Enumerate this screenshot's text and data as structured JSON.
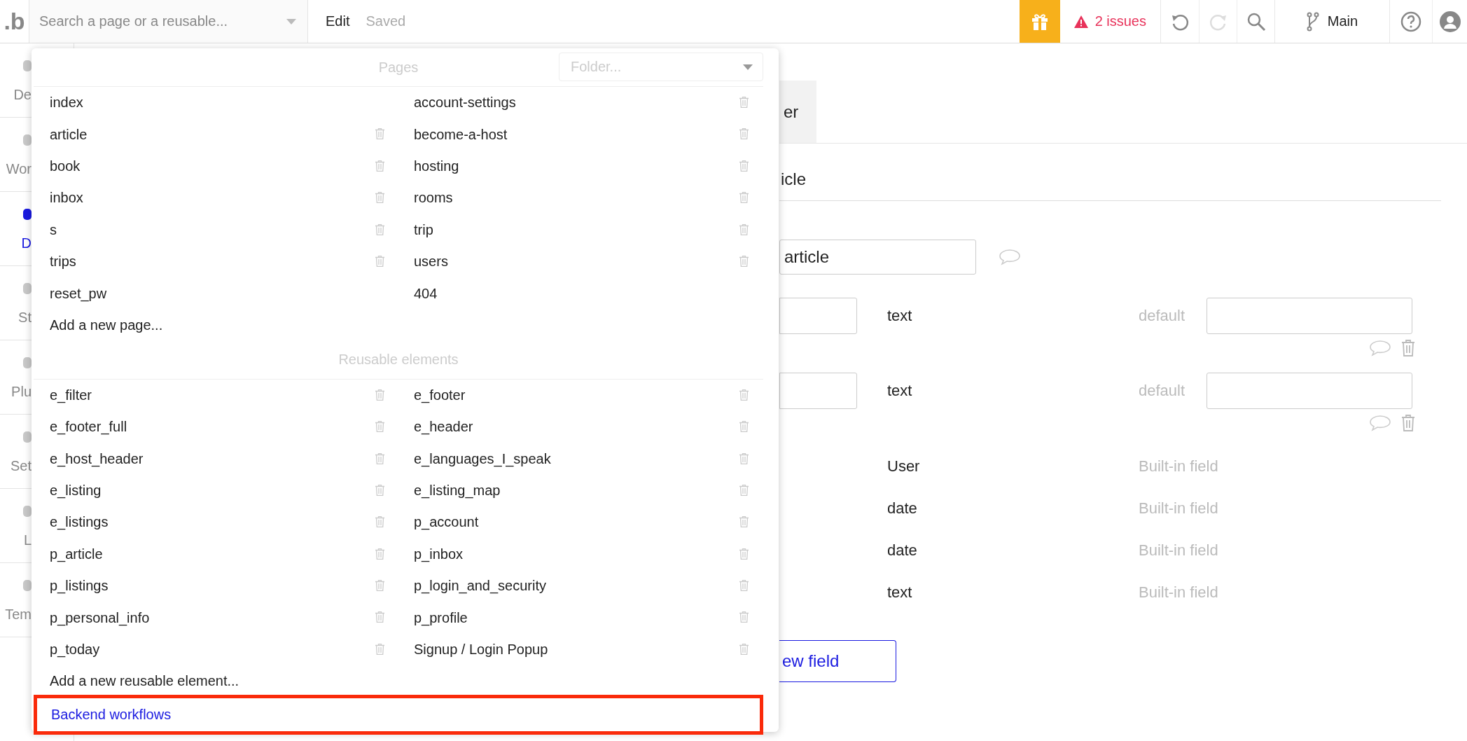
{
  "header": {
    "logo": ".b",
    "search": {
      "placeholder": "Search a page or a reusable..."
    },
    "mode": "Edit",
    "save_status": "Saved",
    "issues": "2 issues",
    "undo_disabled": false,
    "redo_disabled": true,
    "branch": "Main"
  },
  "sidebar": {
    "items": [
      {
        "label": "De",
        "selected": false
      },
      {
        "label": "Wor",
        "selected": false
      },
      {
        "label": "D",
        "selected": true
      },
      {
        "label": "St",
        "selected": false
      },
      {
        "label": "Plu",
        "selected": false
      },
      {
        "label": "Set",
        "selected": false
      },
      {
        "label": "L",
        "selected": false
      },
      {
        "label": "Tem",
        "selected": false
      }
    ]
  },
  "page_menu": {
    "folder": {
      "placeholder": "Folder..."
    },
    "sections": [
      {
        "title": "Pages",
        "add_label": "Add a new page...",
        "items": [
          {
            "name": "index",
            "deletable": false
          },
          {
            "name": "account-settings",
            "deletable": true
          },
          {
            "name": "article",
            "deletable": true
          },
          {
            "name": "become-a-host",
            "deletable": true
          },
          {
            "name": "book",
            "deletable": true
          },
          {
            "name": "hosting",
            "deletable": true
          },
          {
            "name": "inbox",
            "deletable": true
          },
          {
            "name": "rooms",
            "deletable": true
          },
          {
            "name": "s",
            "deletable": true
          },
          {
            "name": "trip",
            "deletable": true
          },
          {
            "name": "trips",
            "deletable": true
          },
          {
            "name": "users",
            "deletable": true
          },
          {
            "name": "reset_pw",
            "deletable": false
          },
          {
            "name": "404",
            "deletable": false
          }
        ]
      },
      {
        "title": "Reusable elements",
        "add_label": "Add a new reusable element...",
        "items": [
          {
            "name": "e_filter",
            "deletable": true
          },
          {
            "name": "e_footer",
            "deletable": true
          },
          {
            "name": "e_footer_full",
            "deletable": true
          },
          {
            "name": "e_header",
            "deletable": true
          },
          {
            "name": "e_host_header",
            "deletable": true
          },
          {
            "name": "e_languages_I_speak",
            "deletable": true
          },
          {
            "name": "e_listing",
            "deletable": true
          },
          {
            "name": "e_listing_map",
            "deletable": true
          },
          {
            "name": "e_listings",
            "deletable": true
          },
          {
            "name": "p_account",
            "deletable": true
          },
          {
            "name": "p_article",
            "deletable": true
          },
          {
            "name": "p_inbox",
            "deletable": true
          },
          {
            "name": "p_listings",
            "deletable": true
          },
          {
            "name": "p_login_and_security",
            "deletable": true
          },
          {
            "name": "p_personal_info",
            "deletable": true
          },
          {
            "name": "p_profile",
            "deletable": true
          },
          {
            "name": "p_today",
            "deletable": true
          },
          {
            "name": "Signup / Login Popup",
            "deletable": true
          }
        ]
      }
    ],
    "backend_link": {
      "label": "Backend workflows",
      "highlighted": true
    }
  },
  "editor": {
    "tab": "er",
    "type_name": "icle",
    "name_field": {
      "value": "article"
    },
    "fields": [
      {
        "kind": "custom",
        "type": "text",
        "default_label": "default"
      },
      {
        "kind": "custom",
        "type": "text",
        "default_label": "default"
      },
      {
        "kind": "builtin",
        "type": "User",
        "note": "Built-in field"
      },
      {
        "kind": "builtin",
        "type": "date",
        "note": "Built-in field"
      },
      {
        "kind": "builtin",
        "type": "date",
        "note": "Built-in field"
      },
      {
        "kind": "builtin",
        "type": "text",
        "note": "Built-in field"
      }
    ],
    "add_button": "ew field"
  }
}
